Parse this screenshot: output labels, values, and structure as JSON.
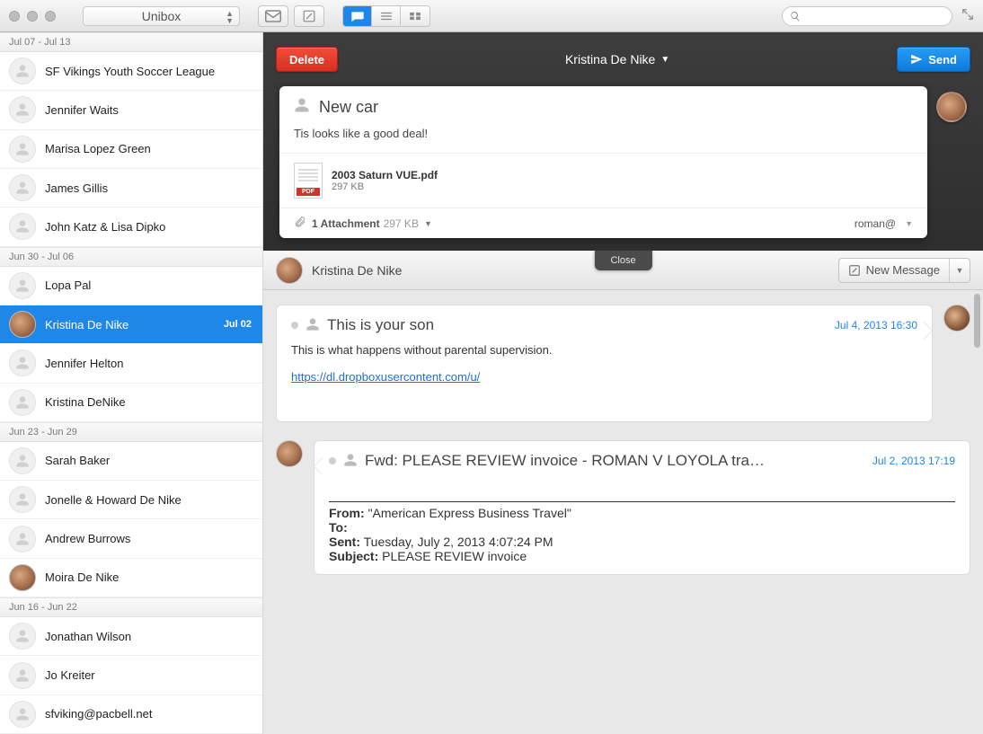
{
  "titlebar": {
    "app_name": "Unibox"
  },
  "search": {
    "placeholder": ""
  },
  "sidebar": [
    {
      "type": "header",
      "label": "Jul 07 - Jul 13"
    },
    {
      "type": "item",
      "name": "SF Vikings Youth Soccer League"
    },
    {
      "type": "item",
      "name": "Jennifer Waits"
    },
    {
      "type": "item",
      "name": "Marisa Lopez Green"
    },
    {
      "type": "item",
      "name": "James Gillis"
    },
    {
      "type": "item",
      "name": "John Katz & Lisa Dipko"
    },
    {
      "type": "header",
      "label": "Jun 30 - Jul 06"
    },
    {
      "type": "item",
      "name": "Lopa Pal"
    },
    {
      "type": "item",
      "name": "Kristina De Nike",
      "selected": true,
      "date": "Jul 02",
      "photo": true
    },
    {
      "type": "item",
      "name": "Jennifer Helton"
    },
    {
      "type": "item",
      "name": "Kristina DeNike"
    },
    {
      "type": "header",
      "label": "Jun 23 - Jun 29"
    },
    {
      "type": "item",
      "name": "Sarah Baker"
    },
    {
      "type": "item",
      "name": "Jonelle & Howard De Nike"
    },
    {
      "type": "item",
      "name": "Andrew Burrows"
    },
    {
      "type": "item",
      "name": "Moira De Nike",
      "photo": true
    },
    {
      "type": "header",
      "label": "Jun 16 - Jun 22"
    },
    {
      "type": "item",
      "name": "Jonathan Wilson"
    },
    {
      "type": "item",
      "name": "Jo Kreiter"
    },
    {
      "type": "item",
      "name": "sfviking@pacbell.net"
    }
  ],
  "compose": {
    "delete": "Delete",
    "send": "Send",
    "contact": "Kristina De Nike",
    "subject": "New car",
    "body": "Tis looks like a good deal!",
    "attachment_name": "2003 Saturn VUE.pdf",
    "attachment_size": "297 KB",
    "footer_count": "1 Attachment",
    "footer_size": "297 KB",
    "footer_email": "roman@"
  },
  "conv": {
    "close": "Close",
    "name": "Kristina De Nike",
    "new_message": "New Message"
  },
  "messages": [
    {
      "dir": "in",
      "subject": "This is your son",
      "time": "Jul 4, 2013 16:30",
      "body_text": "This is what happens without parental supervision.",
      "body_link": "https://dl.dropboxusercontent.com/u/",
      "avatar": "male"
    },
    {
      "dir": "out",
      "subject": "Fwd: PLEASE REVIEW invoice - ROMAN V LOYOLA tra…",
      "time": "Jul 2, 2013 17:19",
      "avatar": "female",
      "fwd": {
        "from": "\"American Express Business Travel\"",
        "to": "",
        "sent": "Tuesday, July 2, 2013 4:07:24 PM",
        "subject": "PLEASE REVIEW invoice"
      }
    }
  ],
  "fwd_labels": {
    "from": "From:",
    "to": "To:",
    "sent": "Sent:",
    "subject": "Subject:"
  }
}
